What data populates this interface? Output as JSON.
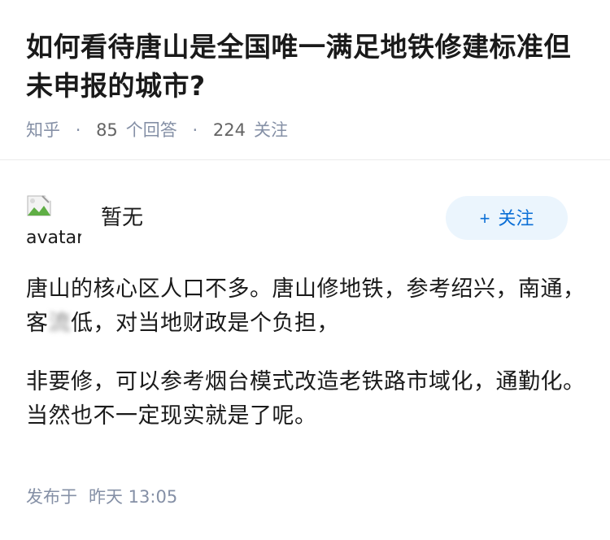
{
  "question": {
    "title": "如何看待唐山是全国唯一满足地铁修建标准但未申报的城市?",
    "site": "知乎",
    "separator": "·",
    "answer_count": "85",
    "answer_label": "个回答",
    "follower_count": "224",
    "follower_label": "关注"
  },
  "answer": {
    "avatar_alt": "avatar",
    "author_name": "暂无",
    "follow_icon": "+",
    "follow_label": "关注",
    "paragraph_1_a": "唐山的核心区人口不多。唐山修地铁，参考绍兴，南通，客",
    "paragraph_1_blur": "流",
    "paragraph_1_b": "低，对当地财政是个负担，",
    "paragraph_2": "非要修，可以参考烟台模式改造老铁路市域化，通勤化。当然也不一定现实就是了呢。",
    "published_label": "发布于",
    "published_time": "昨天 13:05"
  },
  "colors": {
    "accent": "#0b6fd6",
    "follow_bg": "#ebf5fd",
    "meta_text": "#8590a6"
  }
}
